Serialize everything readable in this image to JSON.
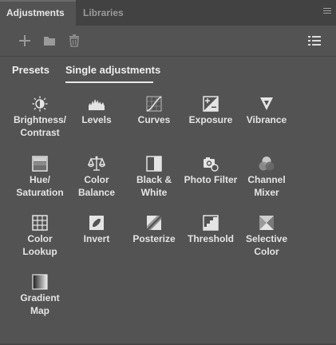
{
  "tabs": [
    {
      "label": "Adjustments",
      "active": true
    },
    {
      "label": "Libraries",
      "active": false
    }
  ],
  "toolbar": {
    "icons": [
      "add-icon",
      "folder-icon",
      "trash-icon",
      "list-icon"
    ]
  },
  "subtabs": [
    {
      "label": "Presets",
      "active": false
    },
    {
      "label": "Single adjustments",
      "active": true
    }
  ],
  "adjustments": [
    {
      "label": "Brightness/\nContrast",
      "icon": "brightness-contrast-icon"
    },
    {
      "label": "Levels",
      "icon": "levels-icon"
    },
    {
      "label": "Curves",
      "icon": "curves-icon"
    },
    {
      "label": "Exposure",
      "icon": "exposure-icon"
    },
    {
      "label": "Vibrance",
      "icon": "vibrance-icon"
    },
    {
      "label": "Hue/\nSaturation",
      "icon": "hue-saturation-icon"
    },
    {
      "label": "Color\nBalance",
      "icon": "color-balance-icon"
    },
    {
      "label": "Black &\nWhite",
      "icon": "black-white-icon"
    },
    {
      "label": "Photo Filter",
      "icon": "photo-filter-icon"
    },
    {
      "label": "Channel\nMixer",
      "icon": "channel-mixer-icon"
    },
    {
      "label": "Color\nLookup",
      "icon": "color-lookup-icon"
    },
    {
      "label": "Invert",
      "icon": "invert-icon"
    },
    {
      "label": "Posterize",
      "icon": "posterize-icon"
    },
    {
      "label": "Threshold",
      "icon": "threshold-icon"
    },
    {
      "label": "Selective\nColor",
      "icon": "selective-color-icon"
    },
    {
      "label": "Gradient\nMap",
      "icon": "gradient-map-icon"
    }
  ]
}
